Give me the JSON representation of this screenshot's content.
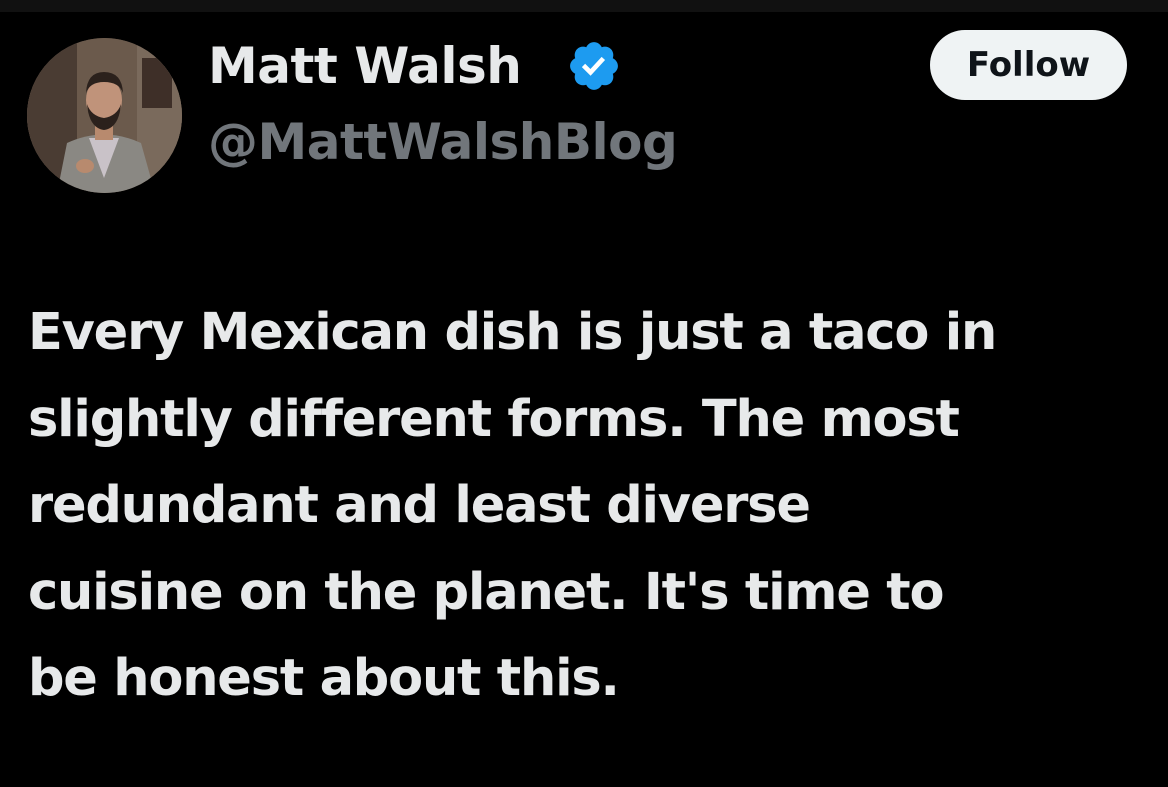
{
  "author": {
    "display_name": "Matt Walsh",
    "handle": "@MattWalshBlog",
    "verified": true,
    "avatar_icon": "profile-photo"
  },
  "follow_button": {
    "label": "Follow"
  },
  "tweet": {
    "lines": [
      "Every Mexican dish is just a taco in",
      "slightly different forms. The most",
      "redundant and least diverse",
      "cuisine on the planet. It's time to",
      "be honest about this."
    ]
  },
  "colors": {
    "background": "#000000",
    "primary_text": "#e7e9ea",
    "secondary_text": "#71767b",
    "verified_badge": "#1d9bf0",
    "follow_button_bg": "#eff3f4",
    "follow_button_text": "#0f1419"
  }
}
